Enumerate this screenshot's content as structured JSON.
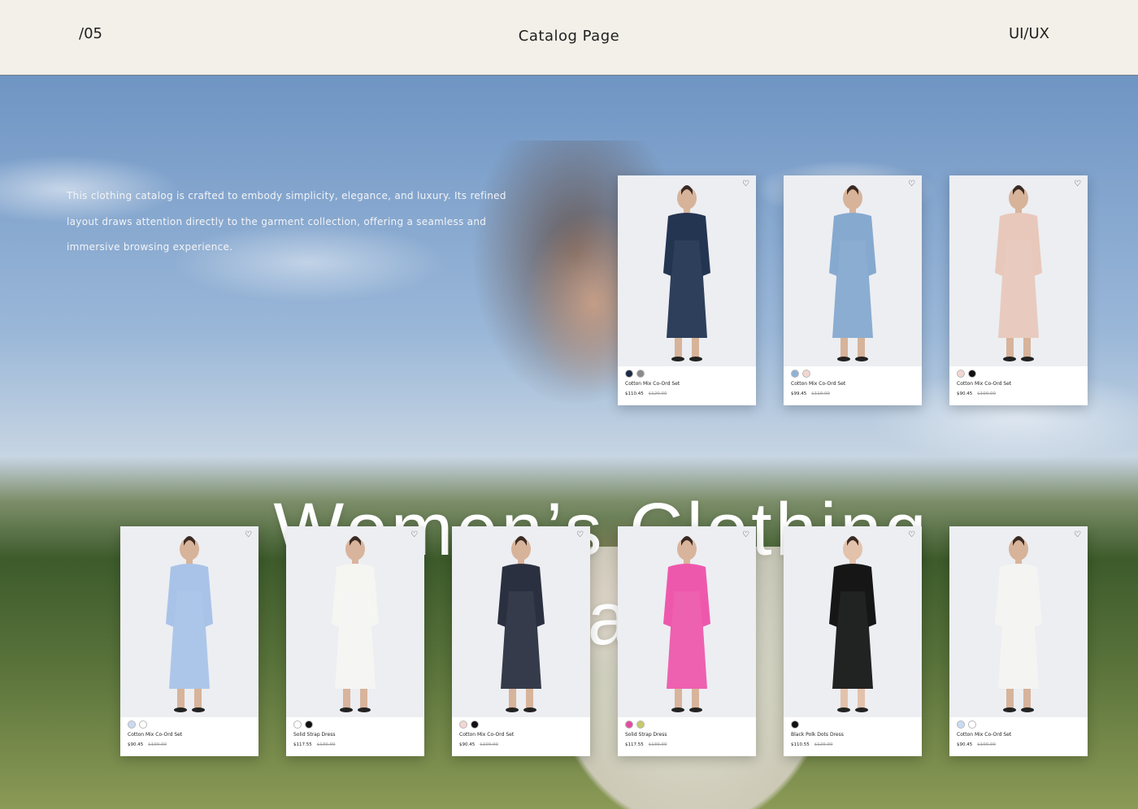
{
  "header": {
    "index": "/05",
    "title": "Catalog Page",
    "tag": "UI/UX"
  },
  "hero": {
    "description": "This clothing catalog is crafted to embody simplicity, elegance, and luxury. Its refined layout draws attention directly to the garment collection, offering a seamless and immersive browsing experience.",
    "headline": "Women’s Clothing Catalog"
  },
  "icons": {
    "favorite": "heart-icon"
  },
  "products": [
    {
      "name": "Cotton Mix Co-Ord Set",
      "price": "$110.45",
      "old_price": "$120.00",
      "swatches": [
        "#1c2a44",
        "#8a8a8a"
      ],
      "garment": "#243552",
      "skin": "#d7b39a"
    },
    {
      "name": "Cotton Mix Co-Ord Set",
      "price": "$99.45",
      "old_price": "$110.00",
      "swatches": [
        "#8fb2d8",
        "#f3d6d2"
      ],
      "garment": "#86a9cf",
      "skin": "#d7b39a"
    },
    {
      "name": "Cotton Mix Co-Ord Set",
      "price": "$90.45",
      "old_price": "$100.00",
      "swatches": [
        "#f3d6d2",
        "#111111"
      ],
      "garment": "#e8c8bb",
      "skin": "#d7b39a"
    },
    {
      "name": "Cotton Mix Co-Ord Set",
      "price": "$90.45",
      "old_price": "$100.00",
      "swatches": [
        "#c9dbf3",
        "#ffffff"
      ],
      "garment": "#a9c3e8",
      "skin": "#d7b39a"
    },
    {
      "name": "Solid Strap Dress",
      "price": "$117.55",
      "old_price": "$130.00",
      "swatches": [
        "#ffffff",
        "#111111"
      ],
      "garment": "#f5f5f2",
      "skin": "#d9b49c"
    },
    {
      "name": "Cotton Mix Co-Ord Set",
      "price": "$90.45",
      "old_price": "$100.00",
      "swatches": [
        "#f3d6d2",
        "#111111"
      ],
      "garment": "#2b3040",
      "skin": "#d7b39a"
    },
    {
      "name": "Solid Strap Dress",
      "price": "$117.55",
      "old_price": "$130.00",
      "swatches": [
        "#e34ba0",
        "#c7c96a"
      ],
      "garment": "#ee58ac",
      "skin": "#d9b49c"
    },
    {
      "name": "Black Polk Dots Dress",
      "price": "$110.55",
      "old_price": "$120.00",
      "swatches": [
        "#111111"
      ],
      "garment": "#161616",
      "skin": "#e3c2ac"
    },
    {
      "name": "Cotton Mix Co-Ord Set",
      "price": "$90.45",
      "old_price": "$100.00",
      "swatches": [
        "#c9dbf3",
        "#ffffff"
      ],
      "garment": "#f4f4f2",
      "skin": "#d7b39a"
    }
  ]
}
